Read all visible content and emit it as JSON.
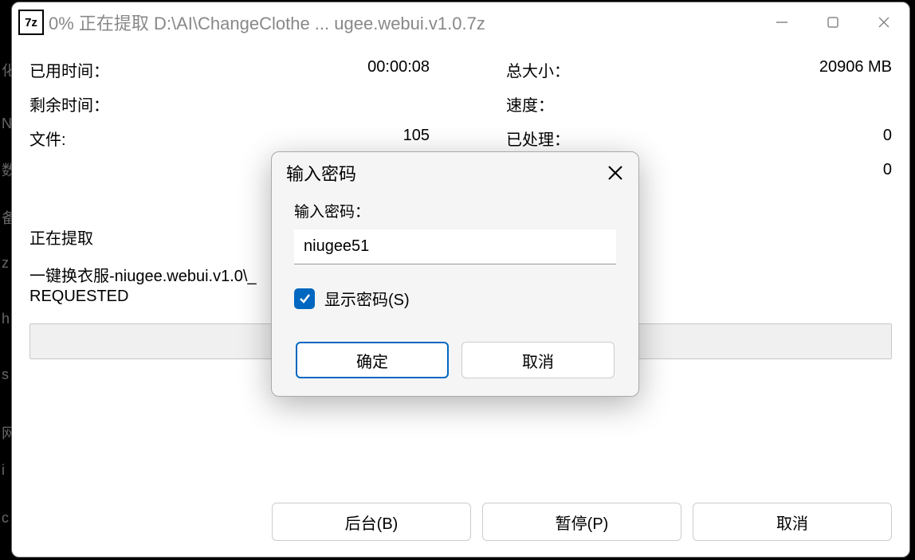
{
  "window": {
    "title": "0% 正在提取 D:\\AI\\ChangeClothe ... ugee.webui.v1.0.7z",
    "icon_text": "7z"
  },
  "stats": {
    "elapsed_label": "已用时间：",
    "elapsed_value": "00:00:08",
    "remaining_label": "剩余时间：",
    "remaining_value": "",
    "files_label": "文件:",
    "files_value": "105",
    "total_label": "总大小：",
    "total_value": "20906 MB",
    "speed_label": "速度：",
    "speed_value": "",
    "processed_label": "已处理：",
    "processed_value": "0",
    "compressed_value": "0"
  },
  "extract": {
    "label": "正在提取",
    "file": "一键换衣服-niugee.webui.v1.0\\_",
    "status": "REQUESTED"
  },
  "buttons": {
    "background": "后台(B)",
    "pause": "暂停(P)",
    "cancel": "取消"
  },
  "dialog": {
    "title": "输入密码",
    "input_label": "输入密码：",
    "password_value": "niugee51",
    "show_password_label": "显示密码(S)",
    "ok": "确定",
    "cancel": "取消"
  }
}
